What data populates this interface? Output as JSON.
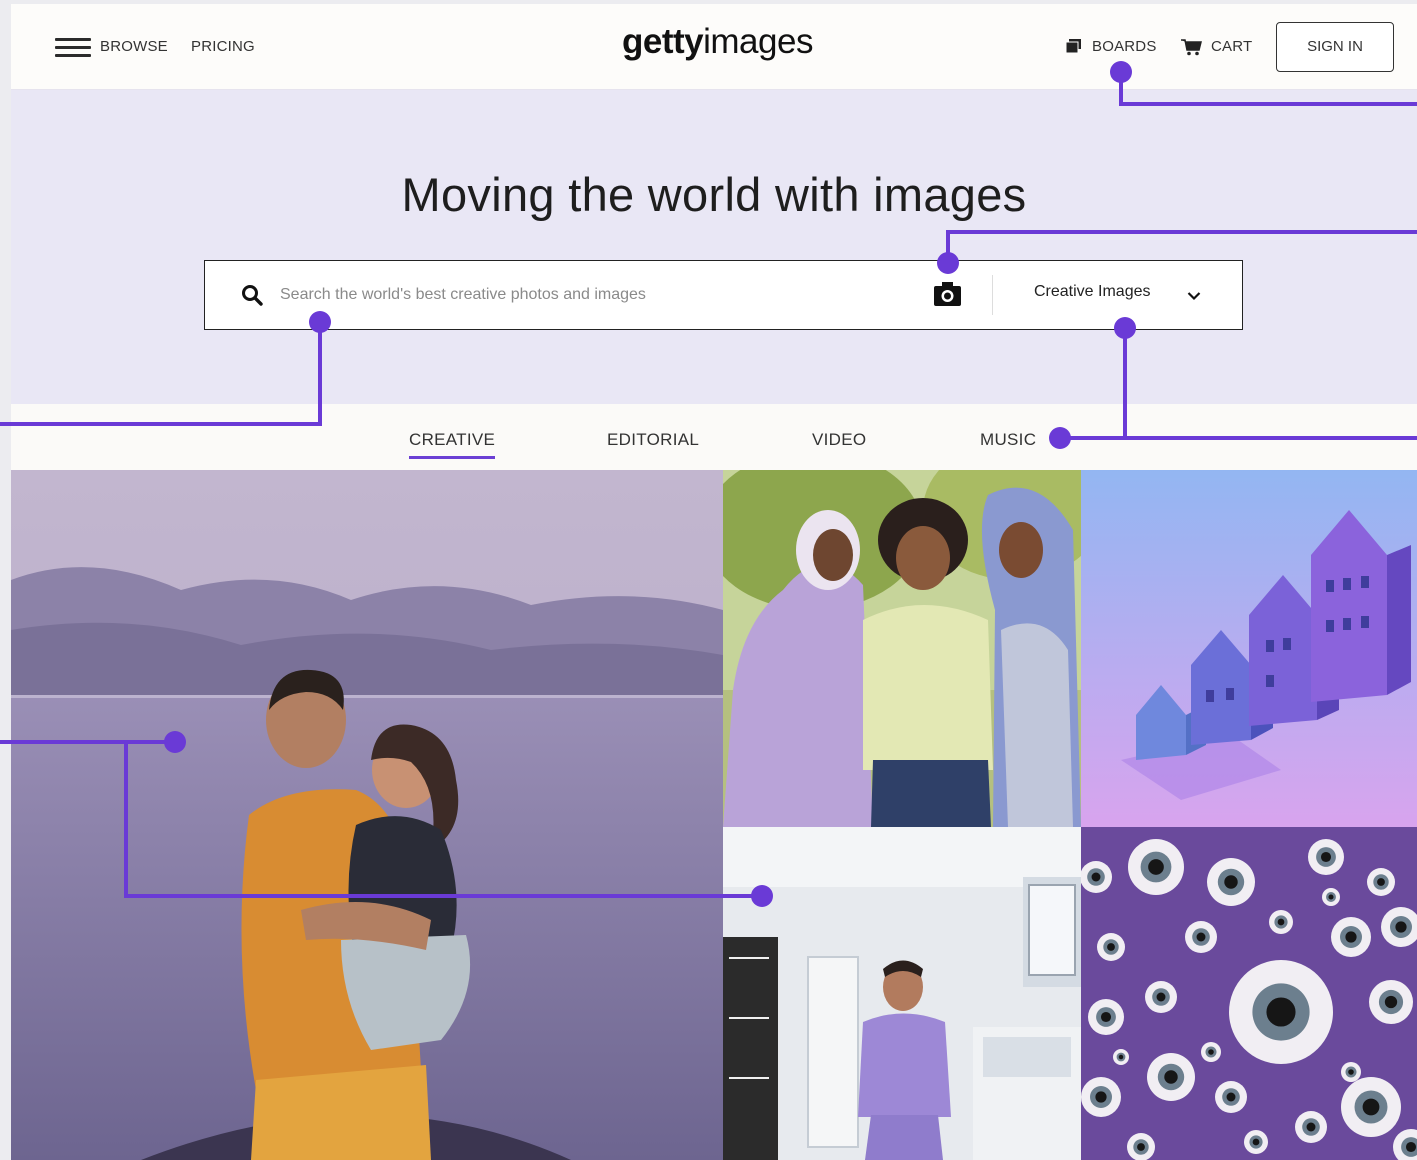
{
  "header": {
    "browse_label": "BROWSE",
    "pricing_label": "PRICING",
    "logo_bold": "getty",
    "logo_light": "images",
    "boards_label": "BOARDS",
    "cart_label": "CART",
    "signin_label": "SIGN IN"
  },
  "hero": {
    "title": "Moving the world with images"
  },
  "search": {
    "placeholder": "Search the world's best creative photos and images",
    "category": "Creative Images"
  },
  "tabs": [
    {
      "label": "CREATIVE",
      "active": true
    },
    {
      "label": "EDITORIAL",
      "active": false
    },
    {
      "label": "VIDEO",
      "active": false
    },
    {
      "label": "MUSIC",
      "active": false
    }
  ],
  "colors": {
    "accent": "#6b3fd4",
    "callout": "#6a3ad6",
    "hero_bg": "#e9e7f5"
  },
  "icons": [
    "hamburger-menu-icon",
    "boards-icon",
    "cart-icon",
    "search-icon",
    "camera-icon",
    "chevron-down-icon"
  ]
}
